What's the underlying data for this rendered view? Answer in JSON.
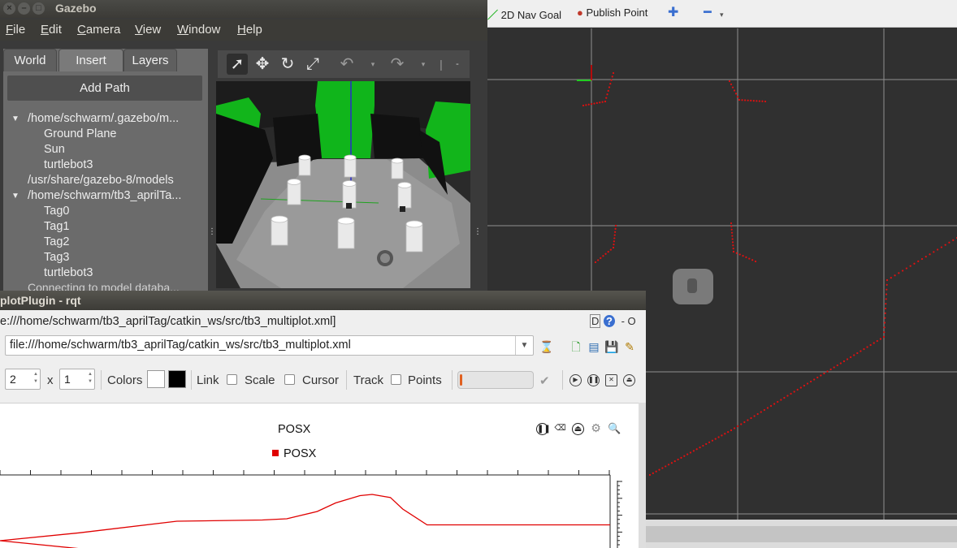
{
  "gazebo": {
    "title": "Gazebo",
    "menu": [
      "File",
      "Edit",
      "Camera",
      "View",
      "Window",
      "Help"
    ],
    "menu_mnemonics": [
      "F",
      "E",
      "C",
      "V",
      "W",
      "H"
    ],
    "tabs": [
      "World",
      "Insert",
      "Layers"
    ],
    "active_tab": "Insert",
    "add_path_label": "Add Path",
    "tree": [
      {
        "label": "/home/schwarm/.gazebo/m...",
        "level": 0,
        "expanded": true
      },
      {
        "label": "Ground Plane",
        "level": 1
      },
      {
        "label": "Sun",
        "level": 1
      },
      {
        "label": "turtlebot3",
        "level": 1
      },
      {
        "label": "/usr/share/gazebo-8/models",
        "level": 0,
        "expanded": false
      },
      {
        "label": "/home/schwarm/tb3_aprilTa...",
        "level": 0,
        "expanded": true
      },
      {
        "label": "Tag0",
        "level": 1
      },
      {
        "label": "Tag1",
        "level": 1
      },
      {
        "label": "Tag2",
        "level": 1
      },
      {
        "label": "Tag3",
        "level": 1
      },
      {
        "label": "turtlebot3",
        "level": 1
      }
    ],
    "status_text": "Connecting to model databa...",
    "toolbar_icons": [
      "select-arrow-icon",
      "translate-icon",
      "rotate-icon",
      "scale-icon",
      "undo-icon",
      "redo-icon"
    ]
  },
  "rviz": {
    "tools": [
      {
        "label": "2D Nav Goal",
        "icon": "nav-goal-arrow-icon",
        "color": "#2db82d"
      },
      {
        "label": "Publish Point",
        "icon": "map-pin-icon",
        "color": "#c0392b"
      }
    ],
    "add_icon": "plus-icon",
    "remove_icon": "minus-icon"
  },
  "rqt": {
    "title": "plotPlugin - rqt",
    "path_label": "e:///home/schwarm/tb3_aprilTag/catkin_ws/src/tb3_multiplot.xml]",
    "help_labels": [
      "D",
      "?",
      "- O"
    ],
    "config_path": "file:///home/schwarm/tb3_aprilTag/catkin_ws/src/tb3_multiplot.xml",
    "rows": "2",
    "x_separator": "x",
    "cols": "1",
    "colors_label": "Colors",
    "link_label": "Link",
    "scale_label": "Scale",
    "cursor_label": "Cursor",
    "track_label": "Track",
    "points_label": "Points",
    "progress": 0.02,
    "color_swatches": [
      "#ffffff",
      "#000000"
    ],
    "accent": "#e06020"
  },
  "chart_data": {
    "type": "line",
    "title": "POSX",
    "xlabel": "",
    "ylabel": "",
    "series": [
      {
        "name": "POSX",
        "color": "#e00000",
        "x": [
          0,
          0.13,
          0.29,
          0.43,
          0.47,
          0.52,
          0.55,
          0.57,
          0.59,
          0.61,
          0.64,
          0.66,
          0.7,
          0.85,
          1.0
        ],
        "y": [
          0.0,
          0.13,
          0.32,
          0.34,
          0.36,
          0.48,
          0.62,
          0.68,
          0.74,
          0.76,
          0.71,
          0.52,
          0.26,
          0.26,
          0.26
        ]
      }
    ],
    "grid": false,
    "legend": "top-center"
  }
}
